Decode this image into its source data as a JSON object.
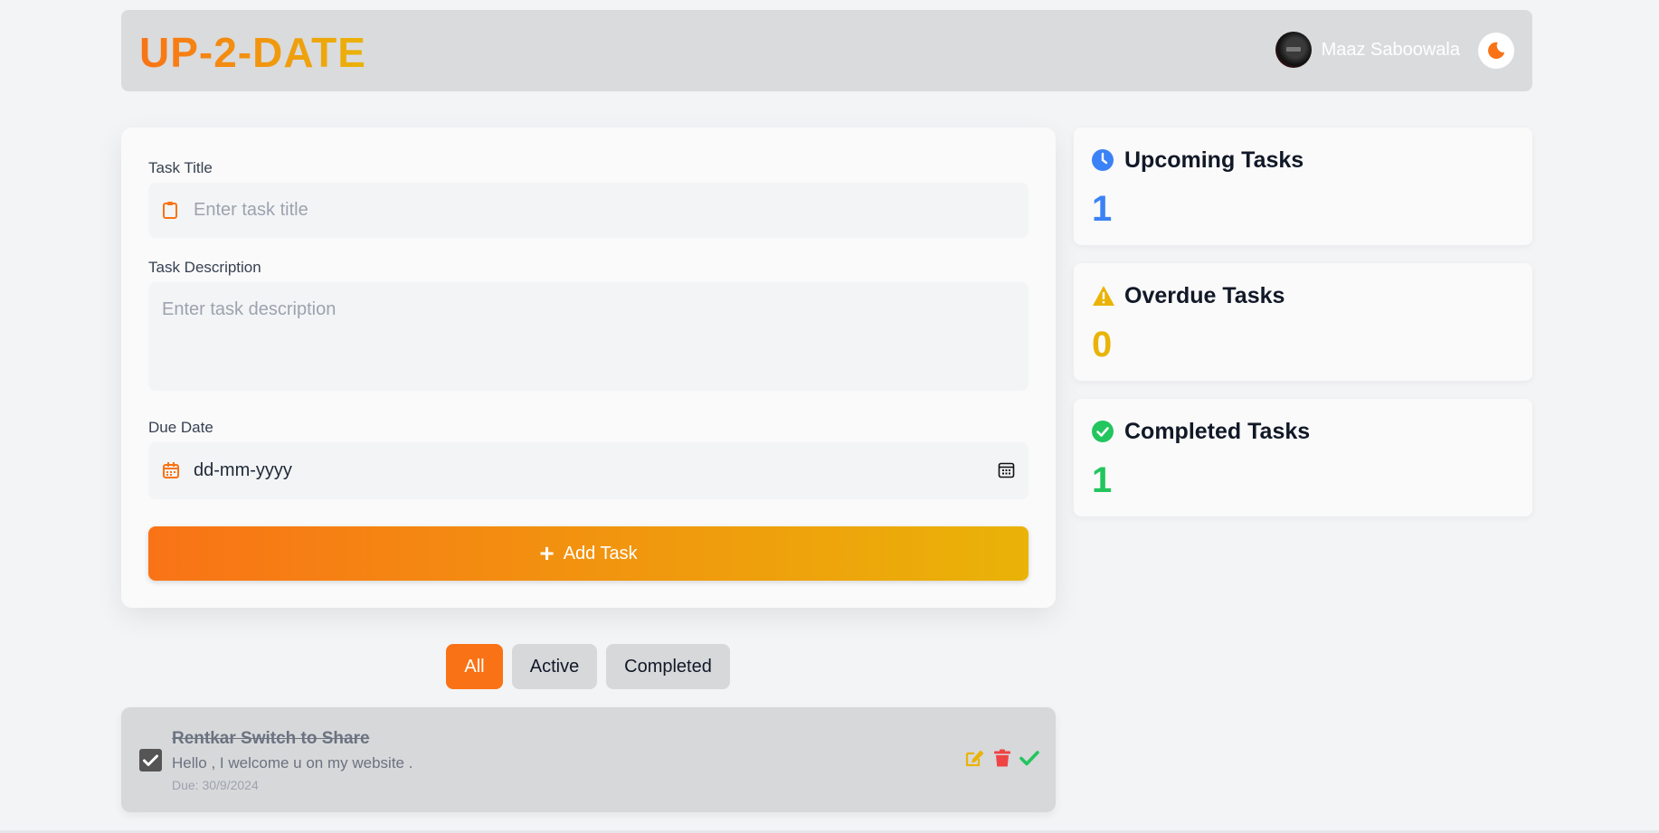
{
  "header": {
    "logo": "UP-2-DATE",
    "user_name": "Maaz Saboowala"
  },
  "form": {
    "title_label": "Task Title",
    "title_placeholder": "Enter task title",
    "desc_label": "Task Description",
    "desc_placeholder": "Enter task description",
    "due_label": "Due Date",
    "due_placeholder": "dd-mm-yyyy",
    "add_button": "Add Task"
  },
  "stats": {
    "upcoming": {
      "label": "Upcoming Tasks",
      "value": "1",
      "color": "#3b82f6"
    },
    "overdue": {
      "label": "Overdue Tasks",
      "value": "0",
      "color": "#eab308"
    },
    "completed": {
      "label": "Completed Tasks",
      "value": "1",
      "color": "#22c55e"
    }
  },
  "filters": {
    "all": "All",
    "active": "Active",
    "completed": "Completed",
    "selected": "All"
  },
  "tasks": [
    {
      "title": "Rentkar Switch to Share",
      "description": "Hello , I welcome u on my website .",
      "due": "Due: 30/9/2024",
      "completed": true
    }
  ],
  "colors": {
    "accent_start": "#f97316",
    "accent_end": "#eab308",
    "edit": "#eab308",
    "delete": "#ef4444",
    "complete": "#22c55e"
  }
}
